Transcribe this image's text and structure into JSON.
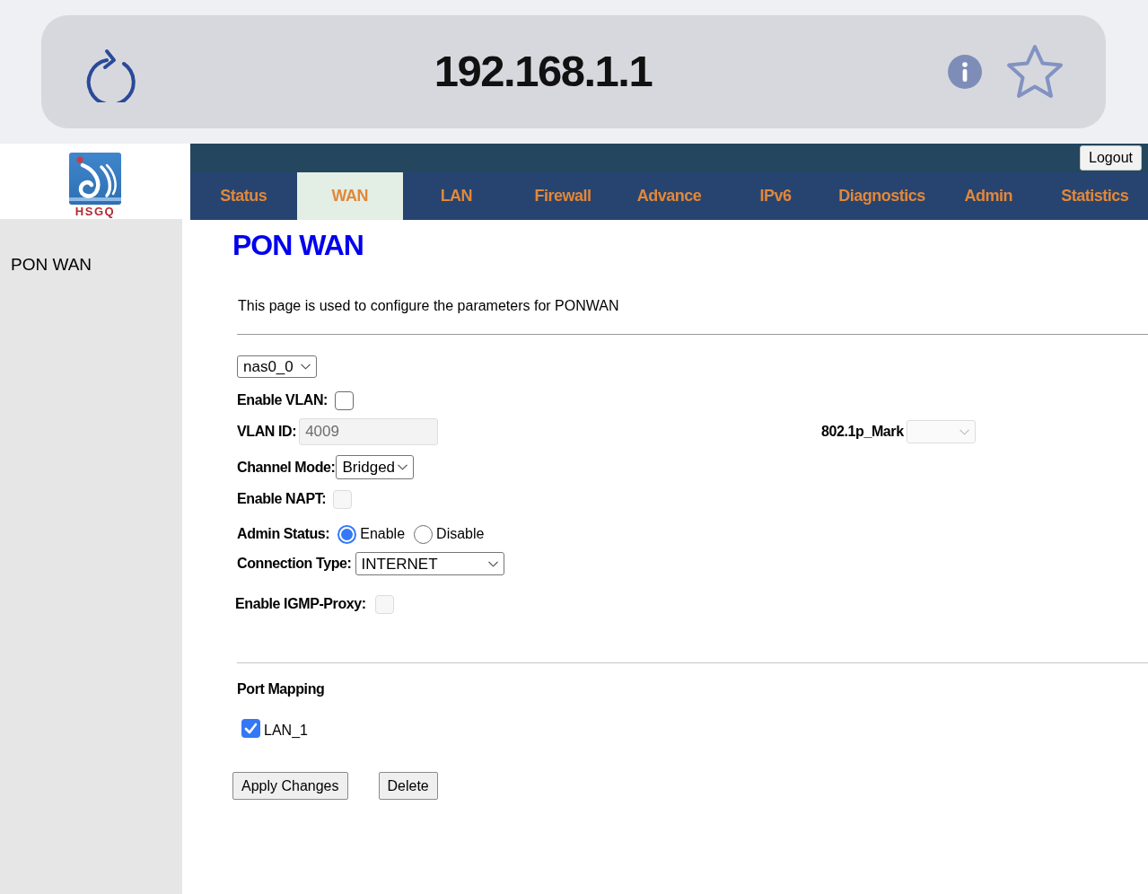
{
  "browser_bar": {
    "url": "192.168.1.1"
  },
  "logo": {
    "text": "HSGQ"
  },
  "header": {
    "logout_button": "Logout"
  },
  "tabs": [
    {
      "label": "Status",
      "selected": false
    },
    {
      "label": "WAN",
      "selected": true
    },
    {
      "label": "LAN",
      "selected": false
    },
    {
      "label": "Firewall",
      "selected": false
    },
    {
      "label": "Advance",
      "selected": false
    },
    {
      "label": "IPv6",
      "selected": false
    },
    {
      "label": "Diagnostics",
      "selected": false
    },
    {
      "label": "Admin",
      "selected": false
    },
    {
      "label": "Statistics",
      "selected": false
    }
  ],
  "sidebar": {
    "items": [
      {
        "label": "PON WAN"
      }
    ]
  },
  "page": {
    "title": "PON WAN",
    "description": "This page is used to configure the parameters for PONWAN"
  },
  "form": {
    "interface": {
      "value": "nas0_0"
    },
    "enable_vlan": {
      "label": "Enable VLAN:",
      "checked": false,
      "disabled": false
    },
    "vlan_id": {
      "label": "VLAN ID:",
      "value": "4009",
      "disabled": true
    },
    "mark_8021p": {
      "label": "802.1p_Mark",
      "disabled": true
    },
    "channel_mode": {
      "label": "Channel Mode:",
      "value": "Bridged"
    },
    "enable_napt": {
      "label": "Enable NAPT:",
      "checked": false,
      "disabled": true
    },
    "admin_status": {
      "label": "Admin Status:",
      "options": [
        {
          "label": "Enable",
          "selected": true
        },
        {
          "label": "Disable",
          "selected": false
        }
      ]
    },
    "connection_type": {
      "label": "Connection Type:",
      "value": "INTERNET"
    },
    "enable_igmp_proxy": {
      "label": "Enable IGMP-Proxy:",
      "checked": false,
      "disabled": true
    }
  },
  "port_mapping": {
    "title": "Port Mapping",
    "ports": [
      {
        "label": "LAN_1",
        "checked": true,
        "disabled": false
      }
    ]
  },
  "buttons": [
    {
      "label": "Apply Changes"
    },
    {
      "label": "Delete"
    }
  ]
}
